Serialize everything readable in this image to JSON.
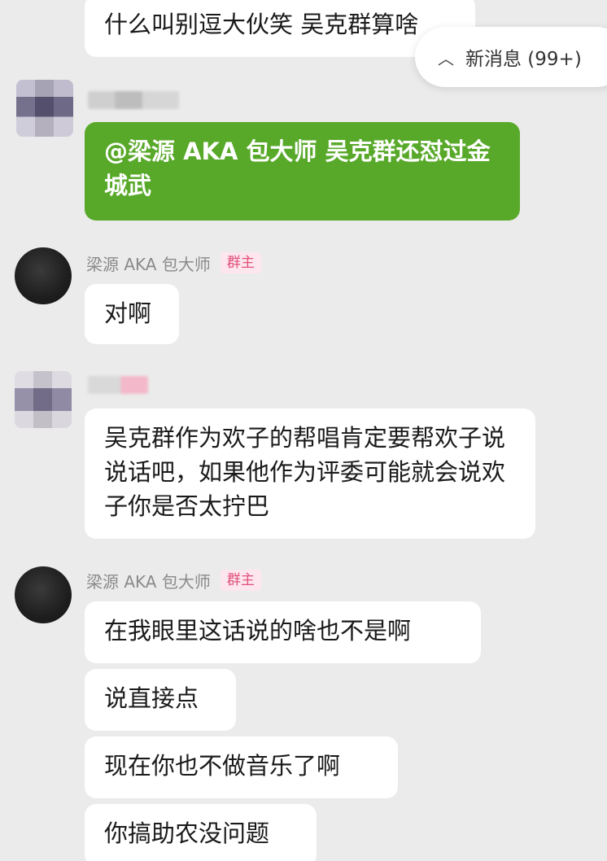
{
  "banner": {
    "icon": "chevron-up-icon",
    "label": "新消息 (99+)"
  },
  "messages": [
    {
      "text": "什么叫别逗大伙笑 吴克群算啥"
    },
    {
      "text": "@梁源 AKA 包大师 吴克群还怼过金城武"
    },
    {
      "sender": "梁源 AKA 包大师",
      "role": "群主",
      "text": "对啊"
    },
    {
      "text": "吴克群作为欢子的帮唱肯定要帮欢子说说话吧，如果他作为评委可能就会说欢子你是否太拧巴"
    },
    {
      "sender": "梁源 AKA 包大师",
      "role": "群主",
      "text": "在我眼里这话说的啥也不是啊"
    },
    {
      "text": "说直接点"
    },
    {
      "text": "现在你也不做音乐了啊"
    },
    {
      "text": "你搞助农没问题"
    }
  ],
  "colors": {
    "background": "#ebebeb",
    "self_bubble": "#58a92a",
    "owner_badge": "#e0507a"
  }
}
